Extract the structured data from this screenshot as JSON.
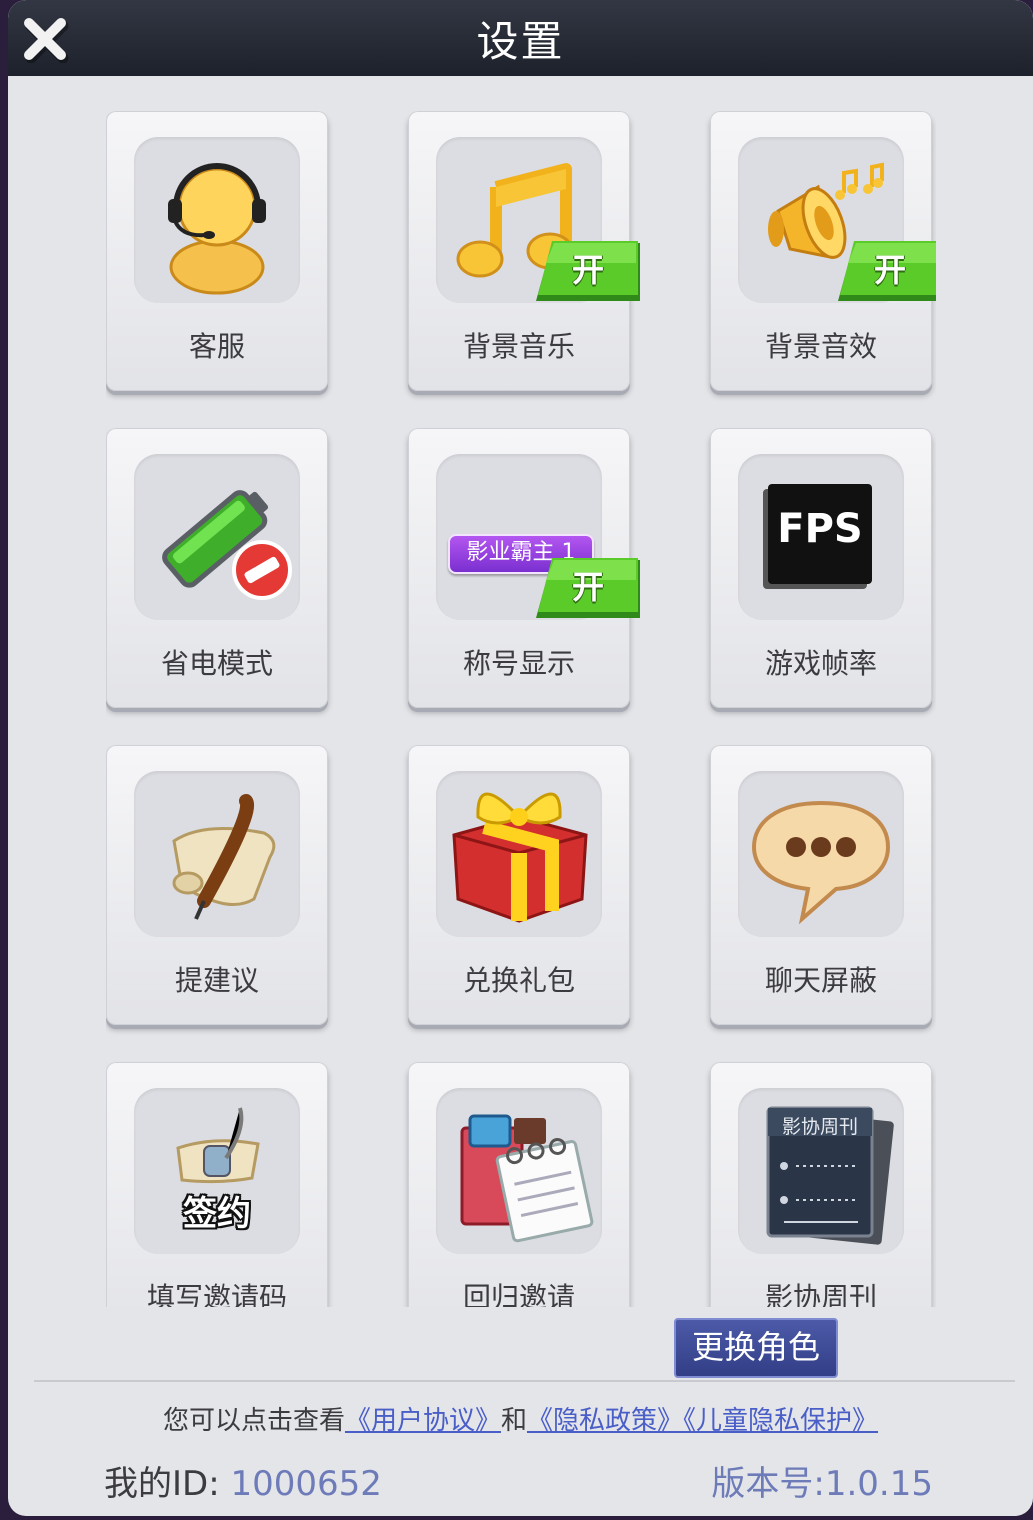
{
  "header": {
    "title": "设置",
    "close_icon": "close-icon"
  },
  "toggle_on_label": "开",
  "tiles": [
    {
      "label": "客服",
      "icon": "customer-service-icon"
    },
    {
      "label": "背景音乐",
      "icon": "music-note-icon",
      "state": "开"
    },
    {
      "label": "背景音效",
      "icon": "speaker-icon",
      "state": "开"
    },
    {
      "label": "省电模式",
      "icon": "battery-saver-icon"
    },
    {
      "label": "称号显示",
      "icon": "title-badge-icon",
      "badge_text": "影业霸主 1",
      "state": "开"
    },
    {
      "label": "游戏帧率",
      "icon": "fps-icon",
      "icon_text": "FPS"
    },
    {
      "label": "提建议",
      "icon": "quill-scroll-icon"
    },
    {
      "label": "兑换礼包",
      "icon": "gift-box-icon"
    },
    {
      "label": "聊天屏蔽",
      "icon": "chat-bubble-icon"
    },
    {
      "label": "填写邀请码",
      "icon": "contract-icon",
      "icon_text": "签约"
    },
    {
      "label": "回归邀请",
      "icon": "gift-calendar-icon"
    },
    {
      "label": "影协周刊",
      "icon": "magazine-icon",
      "icon_text": "影协周刊"
    }
  ],
  "change_role_label": "更换角色",
  "footer": {
    "agreement_prefix": "您可以点击查看",
    "user_agreement": "《用户协议》",
    "and": "和",
    "privacy_policy": "《隐私政策》",
    "child_privacy": "《儿童隐私保护》",
    "my_id_label": "我的ID:",
    "my_id_value": "1000652",
    "version": "版本号:1.0.15"
  }
}
